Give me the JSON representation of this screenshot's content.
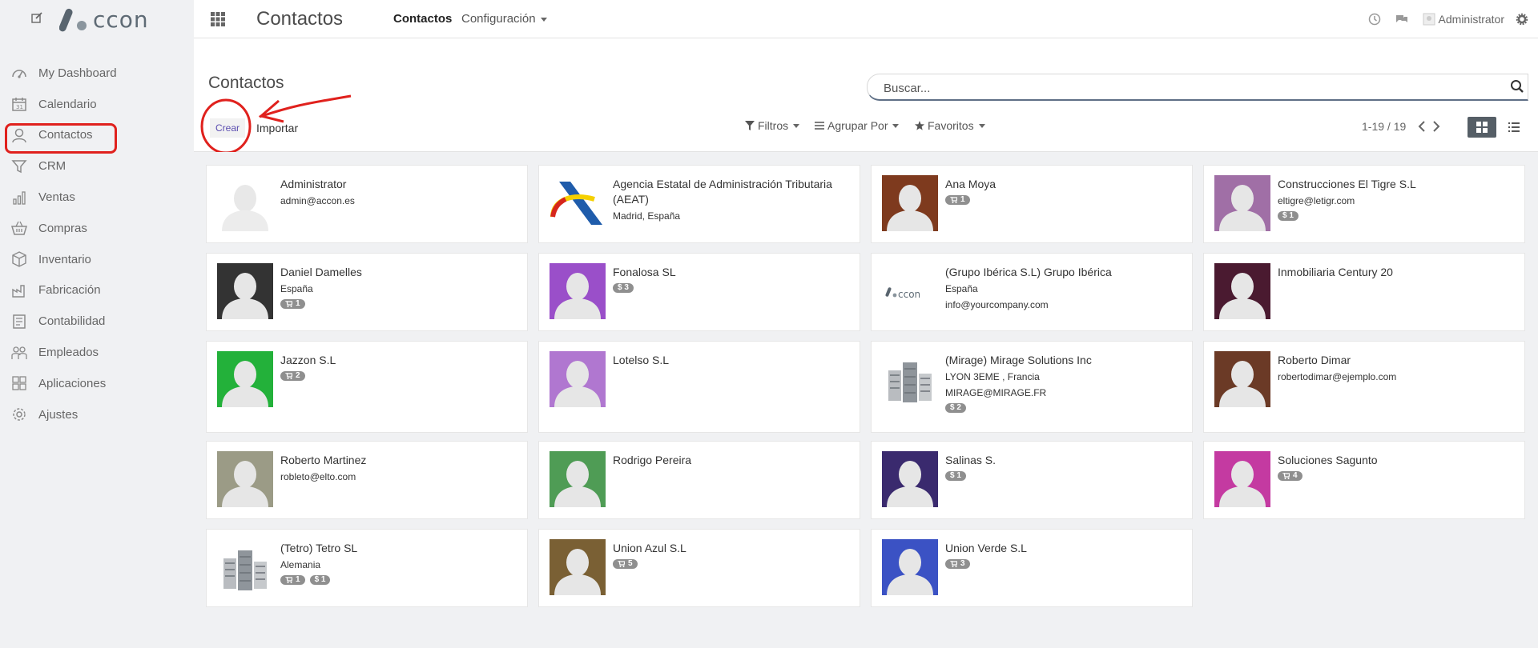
{
  "sidebar": {
    "logo_text": "ccon",
    "items": [
      {
        "label": "My Dashboard",
        "icon": "dashboard-icon"
      },
      {
        "label": "Calendario",
        "icon": "calendar-icon"
      },
      {
        "label": "Contactos",
        "icon": "user-icon"
      },
      {
        "label": "CRM",
        "icon": "funnel-icon"
      },
      {
        "label": "Ventas",
        "icon": "bar-chart-icon"
      },
      {
        "label": "Compras",
        "icon": "basket-icon"
      },
      {
        "label": "Inventario",
        "icon": "box-icon"
      },
      {
        "label": "Fabricación",
        "icon": "factory-icon"
      },
      {
        "label": "Contabilidad",
        "icon": "ledger-icon"
      },
      {
        "label": "Empleados",
        "icon": "employees-icon"
      },
      {
        "label": "Aplicaciones",
        "icon": "apps-grid-icon"
      },
      {
        "label": "Ajustes",
        "icon": "gear-icon"
      }
    ]
  },
  "topbar": {
    "app_title": "Contactos",
    "nav": [
      {
        "label": "Contactos"
      },
      {
        "label": "Configuración"
      }
    ],
    "user_name": "Administrator"
  },
  "control": {
    "title": "Contactos",
    "search_placeholder": "Buscar...",
    "create_label": "Crear",
    "import_label": "Importar",
    "filters_label": "Filtros",
    "groupby_label": "Agrupar Por",
    "favorites_label": "Favoritos",
    "pager": "1-19 / 19"
  },
  "colors": {
    "annotation": "#e0211d",
    "avatar_backgrounds": [
      "#ffffff",
      "#ffffff",
      "#7e3a1e",
      "#a06fa6",
      "#333333",
      "#9a4fc9",
      "#ffffff",
      "#4a1a30",
      "#23b13a",
      "#b077d0",
      "#ffffff",
      "#6b3a26",
      "#9b9b86",
      "#4f9c55",
      "#3a2a6e",
      "#c43aa1",
      "#ffffff",
      "#7a6034",
      "#3b52c4"
    ]
  },
  "contacts": [
    {
      "name": "Administrator",
      "lines": [
        "admin@accon.es"
      ],
      "badges": []
    },
    {
      "name": "Agencia Estatal de Administración Tributaria (AEAT)",
      "lines": [
        "Madrid, España"
      ],
      "badges": []
    },
    {
      "name": "Ana Moya",
      "lines": [],
      "badges": [
        {
          "icon": "cart-icon",
          "text": "1"
        }
      ]
    },
    {
      "name": "Construcciones El Tigre S.L",
      "lines": [
        "eltigre@letigr.com"
      ],
      "badges": [
        {
          "icon": "dollar",
          "text": "$ 1"
        }
      ]
    },
    {
      "name": "Daniel Damelles",
      "lines": [
        "España"
      ],
      "badges": [
        {
          "icon": "cart-icon",
          "text": "1"
        }
      ]
    },
    {
      "name": "Fonalosa SL",
      "lines": [],
      "badges": [
        {
          "icon": "dollar",
          "text": "$ 3"
        }
      ]
    },
    {
      "name": "(Grupo Ibérica S.L) Grupo Ibérica",
      "lines": [
        "España",
        "info@yourcompany.com"
      ],
      "badges": []
    },
    {
      "name": "Inmobiliaria Century 20",
      "lines": [],
      "badges": []
    },
    {
      "name": "Jazzon S.L",
      "lines": [],
      "badges": [
        {
          "icon": "cart-icon",
          "text": "2"
        }
      ]
    },
    {
      "name": "Lotelso S.L",
      "lines": [],
      "badges": []
    },
    {
      "name": "(Mirage) Mirage Solutions Inc",
      "lines": [
        "LYON 3EME , Francia",
        "MIRAGE@MIRAGE.FR"
      ],
      "badges": [
        {
          "icon": "dollar",
          "text": "$ 2"
        }
      ]
    },
    {
      "name": "Roberto Dimar",
      "lines": [
        "robertodimar@ejemplo.com"
      ],
      "badges": []
    },
    {
      "name": "Roberto Martinez",
      "lines": [
        "robleto@elto.com"
      ],
      "badges": []
    },
    {
      "name": "Rodrigo Pereira",
      "lines": [],
      "badges": []
    },
    {
      "name": "Salinas S.",
      "lines": [],
      "badges": [
        {
          "icon": "dollar",
          "text": "$ 1"
        }
      ]
    },
    {
      "name": "Soluciones Sagunto",
      "lines": [],
      "badges": [
        {
          "icon": "cart-icon",
          "text": "4"
        }
      ]
    },
    {
      "name": "(Tetro) Tetro SL",
      "lines": [
        "Alemania"
      ],
      "badges": [
        {
          "icon": "cart-icon",
          "text": "1"
        },
        {
          "icon": "dollar",
          "text": "$ 1"
        }
      ]
    },
    {
      "name": "Union Azul S.L",
      "lines": [],
      "badges": [
        {
          "icon": "cart-icon",
          "text": "5"
        }
      ]
    },
    {
      "name": "Union Verde S.L",
      "lines": [],
      "badges": [
        {
          "icon": "cart-icon",
          "text": "3"
        }
      ]
    }
  ]
}
